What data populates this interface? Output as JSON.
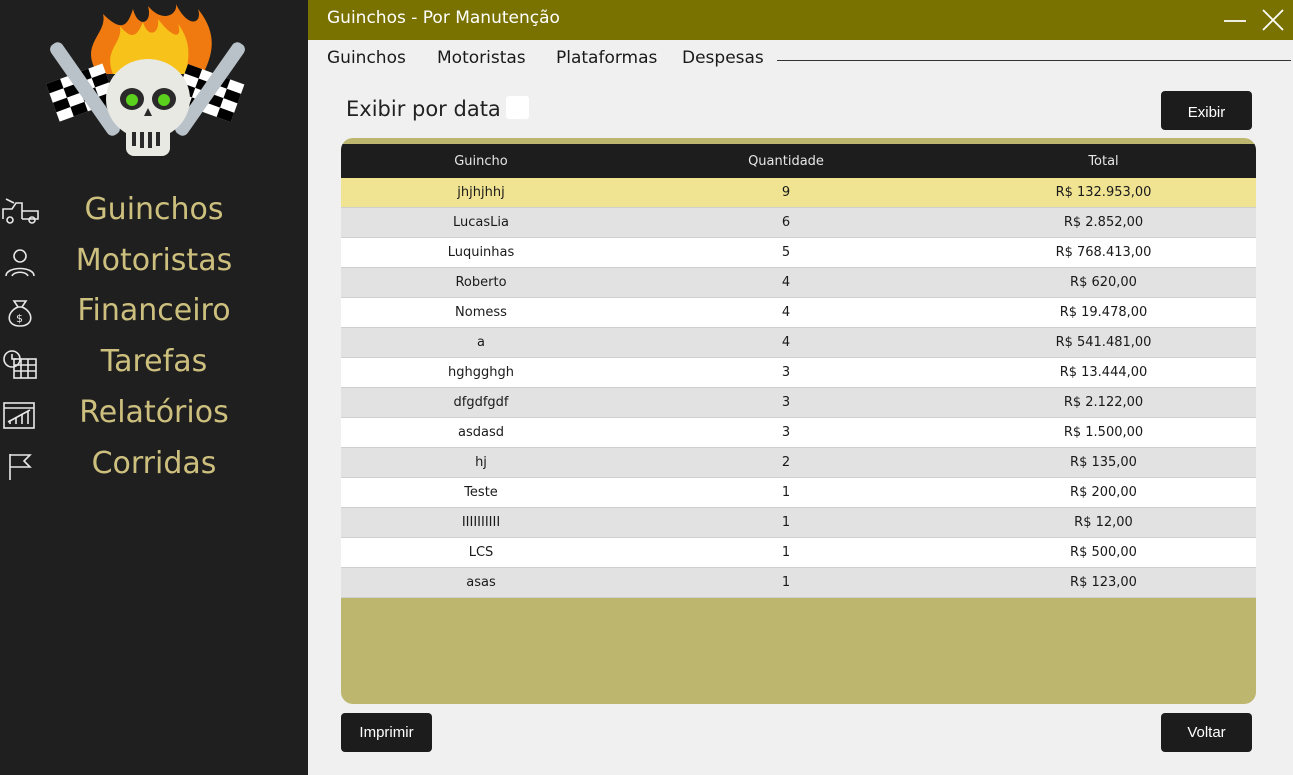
{
  "window": {
    "title": "Guinchos - Por Manutenção"
  },
  "menu": {
    "items": [
      "Guinchos",
      "Motoristas",
      "Plataformas",
      "Despesas"
    ]
  },
  "sidebar": {
    "items": [
      {
        "label": "Guinchos",
        "icon": "tow-truck-icon"
      },
      {
        "label": "Motoristas",
        "icon": "driver-icon"
      },
      {
        "label": "Financeiro",
        "icon": "money-bag-icon"
      },
      {
        "label": "Tarefas",
        "icon": "calendar-clock-icon"
      },
      {
        "label": "Relatórios",
        "icon": "report-chart-icon"
      },
      {
        "label": "Corridas",
        "icon": "flag-icon"
      }
    ]
  },
  "filter": {
    "label": "Exibir por data",
    "checked": false,
    "button": "Exibir"
  },
  "table": {
    "columns": [
      "Guincho",
      "Quantidade",
      "Total"
    ],
    "selected_row": 0,
    "rows": [
      [
        "jhjhjhhj",
        "9",
        "R$ 132.953,00"
      ],
      [
        "LucasLia",
        "6",
        "R$ 2.852,00"
      ],
      [
        "Luquinhas",
        "5",
        "R$ 768.413,00"
      ],
      [
        "Roberto",
        "4",
        "R$ 620,00"
      ],
      [
        "Nomess",
        "4",
        "R$ 19.478,00"
      ],
      [
        "a",
        "4",
        "R$ 541.481,00"
      ],
      [
        "hghgghgh",
        "3",
        "R$ 13.444,00"
      ],
      [
        "dfgdfgdf",
        "3",
        "R$ 2.122,00"
      ],
      [
        "asdasd",
        "3",
        "R$ 1.500,00"
      ],
      [
        "hj",
        "2",
        "R$ 135,00"
      ],
      [
        "Teste",
        "1",
        "R$ 200,00"
      ],
      [
        "IIIIIIIIII",
        "1",
        "R$ 12,00"
      ],
      [
        "LCS",
        "1",
        "R$ 500,00"
      ],
      [
        "asas",
        "1",
        "R$ 123,00"
      ]
    ]
  },
  "actions": {
    "print": "Imprimir",
    "back": "Voltar"
  },
  "colors": {
    "accent": "#7a7200",
    "sidebar": "#1f1f1f",
    "nav_text": "#cdc07e",
    "table_frame": "#bdb66f",
    "selected_row": "#f0e391"
  }
}
